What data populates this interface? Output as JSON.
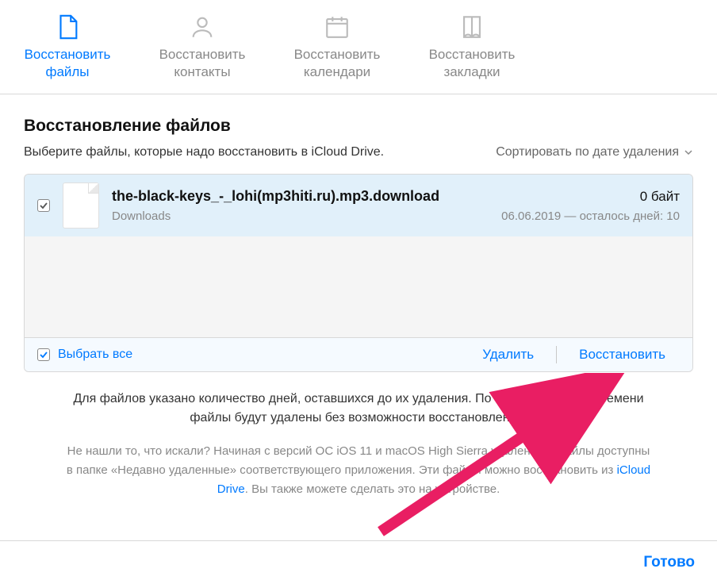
{
  "tabs": [
    {
      "label": "Восстановить\nфайлы",
      "active": true
    },
    {
      "label": "Восстановить\nконтакты",
      "active": false
    },
    {
      "label": "Восстановить\nкалендари",
      "active": false
    },
    {
      "label": "Восстановить\nзакладки",
      "active": false
    }
  ],
  "section": {
    "title": "Восстановление файлов",
    "description": "Выберите файлы, которые надо восстановить в iCloud Drive.",
    "sort_label": "Сортировать по дате удаления"
  },
  "files": [
    {
      "name": "the-black-keys_-_lohi(mp3hiti.ru).mp3.download",
      "size": "0 байт",
      "folder": "Downloads",
      "date": "06.06.2019",
      "remaining": "осталось дней: 10",
      "checked": true
    }
  ],
  "footer": {
    "select_all": "Выбрать все",
    "delete": "Удалить",
    "restore": "Восстановить"
  },
  "notes": {
    "main": "Для файлов указано количество дней, оставшихся до их удаления. По истечении этого времени файлы будут удалены без возможности восстановления.",
    "secondary_before": "Не нашли то, что искали? Начиная с версий ОС iOS 11 и macOS High Sierra удаленные файлы доступны в папке «Недавно удаленные» соответствующего приложения. Эти файлы можно восстановить из ",
    "secondary_link": "iCloud Drive",
    "secondary_after": ". Вы также можете сделать это на устройстве."
  },
  "done": "Готово"
}
